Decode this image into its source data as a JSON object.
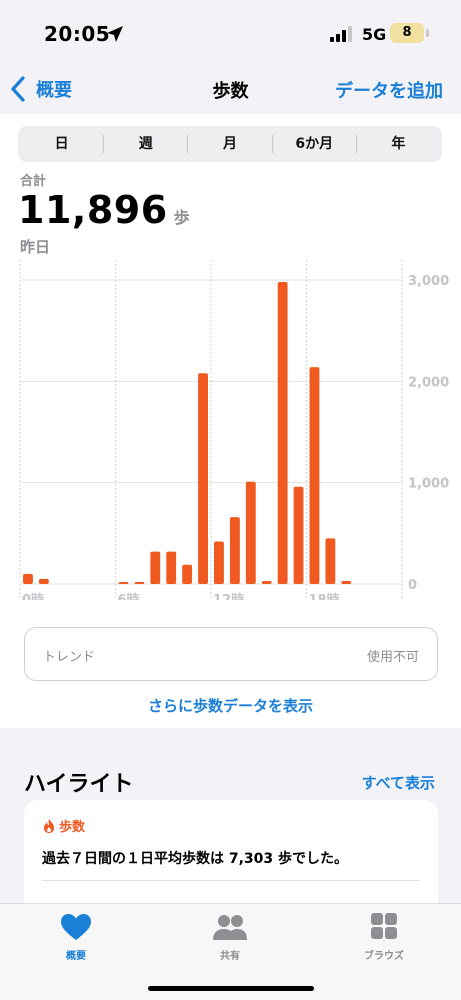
{
  "status": {
    "time": "20:05",
    "network": "5G",
    "battery": "8"
  },
  "nav": {
    "back": "概要",
    "title": "歩数",
    "add": "データを追加"
  },
  "segments": [
    {
      "label": "日",
      "active": true
    },
    {
      "label": "週",
      "active": false
    },
    {
      "label": "月",
      "active": false
    },
    {
      "label": "6か月",
      "active": false
    },
    {
      "label": "年",
      "active": false
    }
  ],
  "summary": {
    "label": "合計",
    "value": "11,896",
    "unit": "歩",
    "date": "昨日"
  },
  "chart_data": {
    "type": "bar",
    "x": [
      0,
      1,
      2,
      3,
      4,
      5,
      6,
      7,
      8,
      9,
      10,
      11,
      12,
      13,
      14,
      15,
      16,
      17,
      18,
      19,
      20,
      21,
      22,
      23
    ],
    "values": [
      100,
      50,
      0,
      0,
      0,
      0,
      10,
      10,
      320,
      320,
      190,
      2080,
      420,
      660,
      1010,
      30,
      2980,
      960,
      2140,
      450,
      30,
      0,
      0,
      0
    ],
    "x_tick_labels": [
      "0時",
      "6時",
      "12時",
      "18時"
    ],
    "y_tick_labels": [
      "0",
      "1,000",
      "2,000",
      "3,000"
    ],
    "ylim": [
      0,
      3000
    ],
    "bar_color": "#f0591f"
  },
  "trend": {
    "label": "トレンド",
    "value": "使用不可"
  },
  "more_link": "さらに歩数データを表示",
  "highlights": {
    "title": "ハイライト",
    "see_all": "すべて表示",
    "card": {
      "tag": "歩数",
      "message": "過去７日間の１日平均歩数は 7,303 歩でした。"
    }
  },
  "tabs": [
    {
      "label": "概要",
      "icon": "heart-icon",
      "active": true
    },
    {
      "label": "共有",
      "icon": "people-icon",
      "active": false
    },
    {
      "label": "ブラウズ",
      "icon": "grid-icon",
      "active": false
    }
  ],
  "colors": {
    "accent": "#1a7fd6",
    "bar": "#f0591f"
  }
}
